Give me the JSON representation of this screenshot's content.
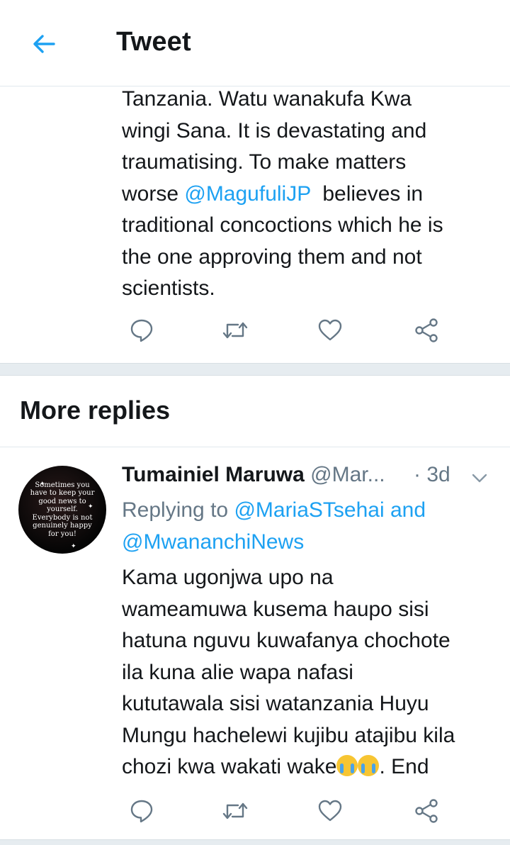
{
  "header": {
    "title": "Tweet"
  },
  "main_tweet": {
    "lines": [
      "Tanzania. Watu wanakufa Kwa",
      "wingi Sana. It is devastating and",
      "traumatising. To make matters"
    ],
    "line4_pre": "worse ",
    "line4_mention": "@MagufuliJP",
    "line4_post": "  believes in",
    "lines_after": [
      "traditional concoctions which he is",
      "the one approving them and not",
      "scientists."
    ]
  },
  "section": {
    "title": "More replies"
  },
  "reply": {
    "name": "Tumainiel Maruwa",
    "handle": "@Mar...",
    "time": "· 3d",
    "replying_prefix": "Replying to ",
    "replying_mention1": "@MariaSTsehai",
    "replying_and": " and",
    "replying_mention2": "@MwananchiNews",
    "text_lines": [
      "Kama ugonjwa upo na",
      "wameamuwa kusema haupo sisi",
      "hatuna nguvu kuwafanya chochote",
      "ila kuna alie wapa nafasi",
      "kututawala sisi watanzania Huyu",
      "Mungu hachelewi kujibu atajibu kila"
    ],
    "last_line_pre": "chozi kwa wakati wake",
    "last_line_post": ". End",
    "emoji_name": "loudly-crying-face-emoji",
    "avatar_text": [
      "Sometimes you",
      "have to keep your",
      "good news to",
      "yourself.",
      "Everybody is not",
      "genuinely happy",
      "for you!"
    ]
  },
  "colors": {
    "accent": "#1da1f2",
    "secondary": "#657786",
    "text": "#14171a",
    "divider": "#e6ecf0"
  },
  "icons": {
    "back": "arrow-left-icon",
    "reply": "comment-icon",
    "retweet": "retweet-icon",
    "like": "heart-icon",
    "share": "share-icon",
    "more": "chevron-down-icon"
  }
}
